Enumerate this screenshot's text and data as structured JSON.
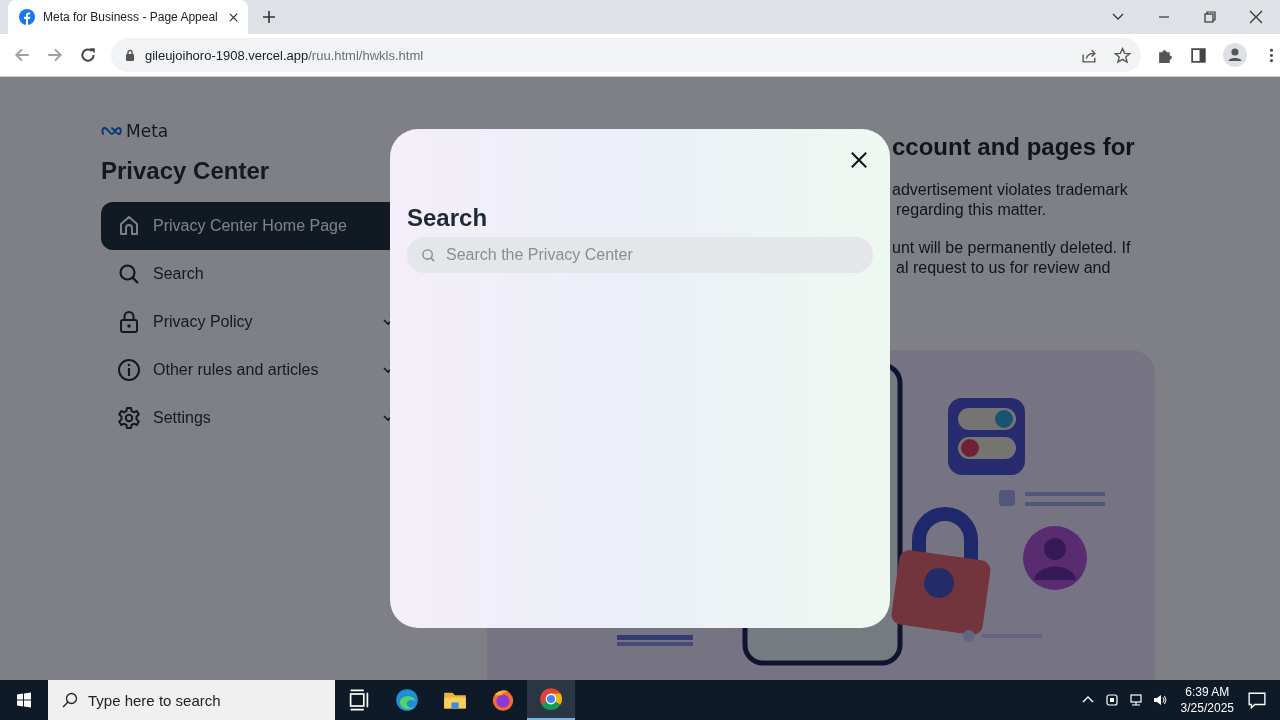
{
  "browser": {
    "tab": {
      "title": "Meta for Business - Page Appeal"
    },
    "address": {
      "domain": "gileujoihoro-1908.vercel.app",
      "path": "/ruu.html/hwkls.html"
    }
  },
  "sidebar": {
    "logo": "Meta",
    "heading": "Privacy Center",
    "items": [
      {
        "label": "Privacy Center Home Page",
        "selected": true,
        "expandable": false
      },
      {
        "label": "Search",
        "selected": false,
        "expandable": false
      },
      {
        "label": "Privacy Policy",
        "selected": false,
        "expandable": true
      },
      {
        "label": "Other rules and articles",
        "selected": false,
        "expandable": true
      },
      {
        "label": "Settings",
        "selected": false,
        "expandable": true
      }
    ]
  },
  "content": {
    "title": "ccount and pages for",
    "paragraphs": [
      [
        "advertisement violates trademark",
        "regarding this matter."
      ],
      [
        "unt will be permanently deleted. If",
        "al request to us for review and"
      ]
    ]
  },
  "modal": {
    "title": "Search",
    "search": {
      "placeholder": "Search the Privacy Center"
    }
  },
  "taskbar": {
    "search": {
      "placeholder": "Type here to search"
    },
    "apps": [
      {
        "selected": false
      },
      {
        "selected": false
      },
      {
        "selected": false
      },
      {
        "selected": false
      },
      {
        "selected": true
      }
    ],
    "time": "6:39 AM",
    "date": "3/25/2025"
  }
}
